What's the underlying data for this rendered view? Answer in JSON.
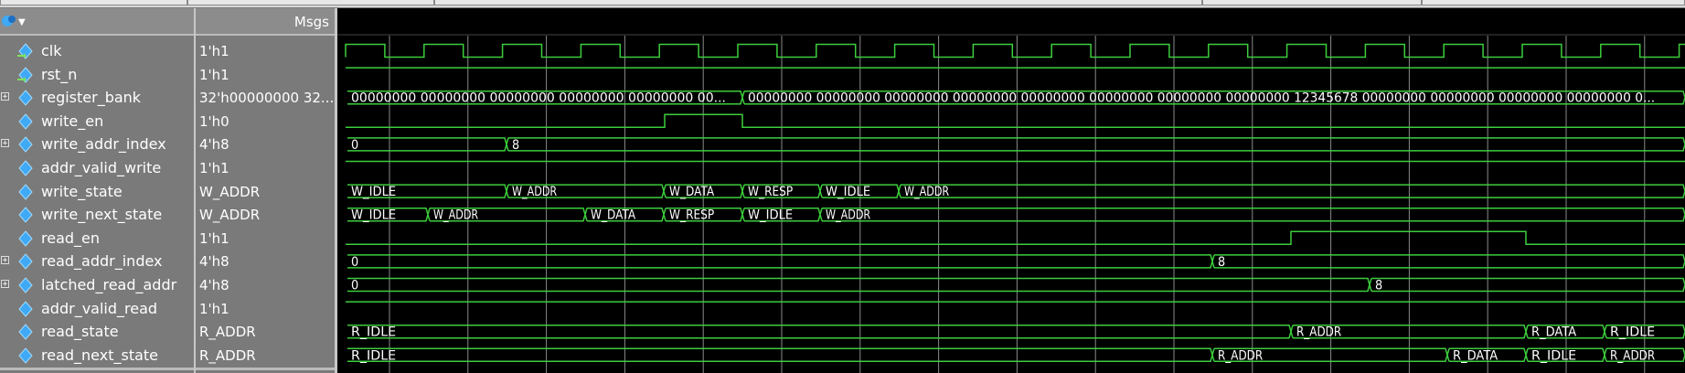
{
  "toolbar": {
    "wave_menu_icon": "wave-icon"
  },
  "header": {
    "msgs_label": "Msgs"
  },
  "signals": [
    {
      "name": "clk",
      "value": "1'h1",
      "kind": "clock",
      "icon": "input-signal-icon",
      "expandable": false
    },
    {
      "name": "rst_n",
      "value": "1'h1",
      "kind": "high",
      "icon": "input-signal-icon",
      "expandable": false
    },
    {
      "name": "register_bank",
      "value": "32'h00000000 32...",
      "kind": "bus",
      "expandable": true,
      "segments": [
        {
          "text": "00000000 00000000 00000000 00000000 00000000 00..."
        },
        {
          "text": "00000000 00000000 00000000 00000000 00000000 00000000 00000000 00000000 12345678 00000000 00000000 00000000 00000000 0..."
        }
      ]
    },
    {
      "name": "write_en",
      "value": "1'h0",
      "kind": "pulse",
      "expandable": false
    },
    {
      "name": "write_addr_index",
      "value": "4'h8",
      "kind": "bus",
      "expandable": true,
      "segments": [
        {
          "text": "0"
        },
        {
          "text": "8"
        }
      ]
    },
    {
      "name": "addr_valid_write",
      "value": "1'h1",
      "kind": "high",
      "expandable": false
    },
    {
      "name": "write_state",
      "value": "W_ADDR",
      "kind": "bus",
      "expandable": false,
      "segments": [
        {
          "text": "W_IDLE"
        },
        {
          "text": "W_ADDR"
        },
        {
          "text": "W_DATA"
        },
        {
          "text": "W_RESP"
        },
        {
          "text": "W_IDLE"
        },
        {
          "text": "W_ADDR"
        }
      ]
    },
    {
      "name": "write_next_state",
      "value": "W_ADDR",
      "kind": "bus",
      "expandable": false,
      "segments": [
        {
          "text": "W_IDLE"
        },
        {
          "text": "W_ADDR"
        },
        {
          "text": "W_DATA"
        },
        {
          "text": "W_RESP"
        },
        {
          "text": "W_IDLE"
        },
        {
          "text": "W_ADDR"
        }
      ]
    },
    {
      "name": "read_en",
      "value": "1'h1",
      "kind": "pulse2",
      "expandable": false
    },
    {
      "name": "read_addr_index",
      "value": "4'h8",
      "kind": "bus",
      "expandable": true,
      "segments": [
        {
          "text": "0"
        },
        {
          "text": "8"
        }
      ]
    },
    {
      "name": "latched_read_addr",
      "value": "4'h8",
      "kind": "bus",
      "expandable": true,
      "segments": [
        {
          "text": "0"
        },
        {
          "text": "8"
        }
      ]
    },
    {
      "name": "addr_valid_read",
      "value": "1'h1",
      "kind": "high",
      "expandable": false
    },
    {
      "name": "read_state",
      "value": "R_ADDR",
      "kind": "bus",
      "expandable": false,
      "segments": [
        {
          "text": "R_IDLE"
        },
        {
          "text": "R_ADDR"
        },
        {
          "text": "R_DATA"
        },
        {
          "text": "R_IDLE"
        }
      ]
    },
    {
      "name": "read_next_state",
      "value": "R_ADDR",
      "kind": "bus",
      "expandable": false,
      "segments": [
        {
          "text": "R_IDLE"
        },
        {
          "text": "R_ADDR"
        },
        {
          "text": "R_DATA"
        },
        {
          "text": "R_IDLE"
        },
        {
          "text": "R_ADDR"
        }
      ]
    }
  ],
  "colors": {
    "wave": "#3ccd3c",
    "grid": "#8a8a8a",
    "text": "#ffffff",
    "panel": "#7a7a7a",
    "icon": "#3fa9f5"
  }
}
